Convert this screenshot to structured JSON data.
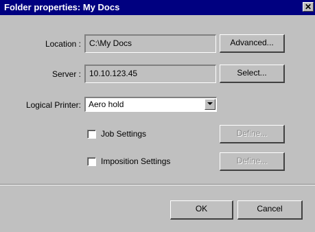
{
  "window": {
    "title": "Folder properties: My Docs",
    "close_symbol": "✕"
  },
  "fields": {
    "location_label": "Location :",
    "location_value": "C:\\My Docs",
    "server_label": "Server :",
    "server_value": "10.10.123.45",
    "printer_label": "Logical Printer:",
    "printer_value": "Aero hold"
  },
  "buttons": {
    "advanced": "Advanced...",
    "select": "Select...",
    "define_job": "Define...",
    "define_imposition": "Define...",
    "ok": "OK",
    "cancel": "Cancel"
  },
  "options": {
    "job_settings_label": "Job Settings",
    "job_settings_checked": false,
    "imposition_settings_label": "Imposition Settings",
    "imposition_settings_checked": false
  },
  "colors": {
    "titlebar": "#000080",
    "face": "#c0c0c0",
    "disabled_text": "#8a8a8a"
  },
  "icons": {
    "close": "close-icon",
    "dropdown": "chevron-down-icon"
  }
}
